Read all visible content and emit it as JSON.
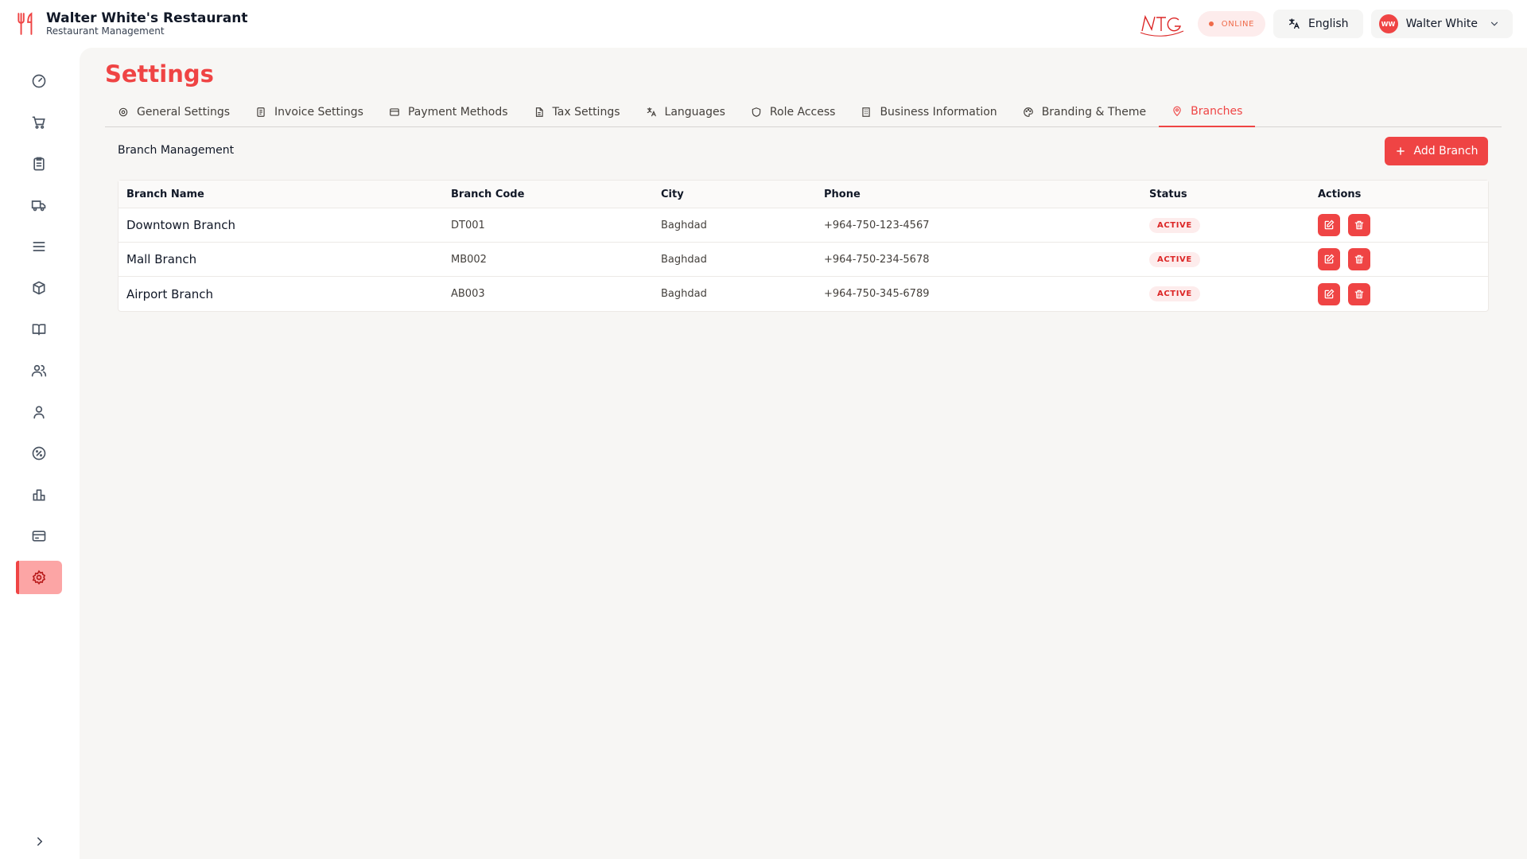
{
  "header": {
    "title": "Walter White's Restaurant",
    "subtitle": "Restaurant Management",
    "status": "ONLINE",
    "language": "English",
    "avatar_initials": "WW",
    "user_name": "Walter White"
  },
  "sidebar": {
    "items": [
      {
        "icon": "dashboard-icon"
      },
      {
        "icon": "cart-icon"
      },
      {
        "icon": "clipboard-icon"
      },
      {
        "icon": "truck-icon"
      },
      {
        "icon": "menu-icon"
      },
      {
        "icon": "package-icon"
      },
      {
        "icon": "book-icon"
      },
      {
        "icon": "users-icon"
      },
      {
        "icon": "user-icon"
      },
      {
        "icon": "discount-icon"
      },
      {
        "icon": "chart-icon"
      },
      {
        "icon": "card-icon"
      },
      {
        "icon": "settings-icon",
        "active": true
      }
    ]
  },
  "page": {
    "title": "Settings",
    "section_label": "Branch Management",
    "add_button": "Add Branch"
  },
  "tabs": [
    {
      "label": "General Settings",
      "icon": "gear-icon"
    },
    {
      "label": "Invoice Settings",
      "icon": "invoice-icon"
    },
    {
      "label": "Payment Methods",
      "icon": "credit-card-icon"
    },
    {
      "label": "Tax Settings",
      "icon": "document-icon"
    },
    {
      "label": "Languages",
      "icon": "translate-icon"
    },
    {
      "label": "Role Access",
      "icon": "shield-icon"
    },
    {
      "label": "Business Information",
      "icon": "building-icon"
    },
    {
      "label": "Branding & Theme",
      "icon": "palette-icon"
    },
    {
      "label": "Branches",
      "icon": "map-pin-icon",
      "active": true
    }
  ],
  "table": {
    "columns": [
      "Branch Name",
      "Branch Code",
      "City",
      "Phone",
      "Status",
      "Actions"
    ],
    "rows": [
      {
        "name": "Downtown Branch",
        "code": "DT001",
        "city": "Baghdad",
        "phone": "+964-750-123-4567",
        "status": "ACTIVE"
      },
      {
        "name": "Mall Branch",
        "code": "MB002",
        "city": "Baghdad",
        "phone": "+964-750-234-5678",
        "status": "ACTIVE"
      },
      {
        "name": "Airport Branch",
        "code": "AB003",
        "city": "Baghdad",
        "phone": "+964-750-345-6789",
        "status": "ACTIVE"
      }
    ]
  },
  "colors": {
    "accent": "#ef4444",
    "badge_bg": "#fdecec",
    "active_side_bg": "#fca5a5"
  }
}
